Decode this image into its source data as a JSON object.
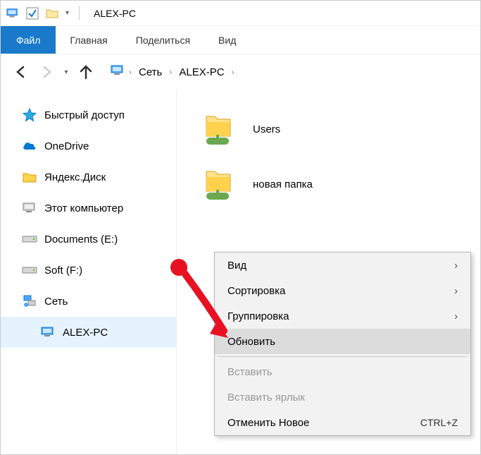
{
  "titlebar": {
    "title": "ALEX-PC"
  },
  "ribbon": {
    "file": "Файл",
    "tabs": [
      "Главная",
      "Поделиться",
      "Вид"
    ]
  },
  "breadcrumb": {
    "items": [
      "Сеть",
      "ALEX-PC"
    ]
  },
  "sidebar": {
    "items": [
      {
        "label": "Быстрый доступ",
        "icon": "star"
      },
      {
        "label": "OneDrive",
        "icon": "cloud"
      },
      {
        "label": "Яндекс.Диск",
        "icon": "yfolder"
      },
      {
        "label": "Этот компьютер",
        "icon": "pc"
      },
      {
        "label": "Documents (E:)",
        "icon": "drive"
      },
      {
        "label": "Soft (F:)",
        "icon": "drive"
      },
      {
        "label": "Сеть",
        "icon": "network"
      },
      {
        "label": "ALEX-PC",
        "icon": "pc",
        "nested": true
      }
    ]
  },
  "content": {
    "items": [
      {
        "label": "Users"
      },
      {
        "label": "новая папка"
      }
    ]
  },
  "contextmenu": {
    "items": [
      {
        "label": "Вид",
        "submenu": true
      },
      {
        "label": "Сортировка",
        "submenu": true
      },
      {
        "label": "Группировка",
        "submenu": true
      },
      {
        "label": "Обновить",
        "hover": true
      },
      {
        "sep": true
      },
      {
        "label": "Вставить",
        "disabled": true
      },
      {
        "label": "Вставить ярлык",
        "disabled": true
      },
      {
        "label": "Отменить Новое",
        "shortcut": "CTRL+Z"
      }
    ]
  }
}
